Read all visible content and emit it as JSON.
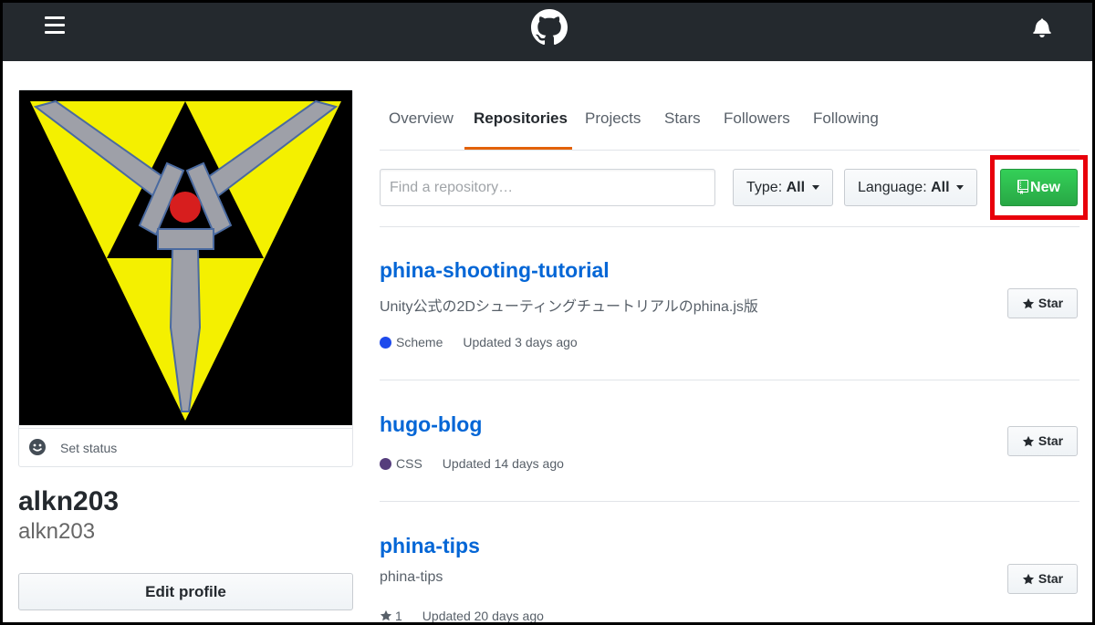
{
  "header": {
    "menu_icon": "hamburger-icon",
    "logo_icon": "github-octocat-icon",
    "notification_icon": "bell-icon"
  },
  "profile": {
    "avatar_alt": "avatar",
    "status_label": "Set status",
    "name": "alkn203",
    "username": "alkn203",
    "edit_button": "Edit profile"
  },
  "tabs": [
    {
      "label": "Overview",
      "active": false
    },
    {
      "label": "Repositories",
      "active": true
    },
    {
      "label": "Projects",
      "active": false
    },
    {
      "label": "Stars",
      "active": false
    },
    {
      "label": "Followers",
      "active": false
    },
    {
      "label": "Following",
      "active": false
    }
  ],
  "filters": {
    "search_placeholder": "Find a repository…",
    "type_label": "Type:",
    "type_value": "All",
    "language_label": "Language:",
    "language_value": "All",
    "new_button": "New"
  },
  "repos": [
    {
      "name": "phina-shooting-tutorial",
      "description": "Unity公式の2Dシューティングチュートリアルのphina.js版",
      "language": "Scheme",
      "language_color": "#1e4aec",
      "stars": "",
      "updated": "Updated 3 days ago",
      "star_button": "Star"
    },
    {
      "name": "hugo-blog",
      "description": "",
      "language": "CSS",
      "language_color": "#563d7c",
      "stars": "",
      "updated": "Updated 14 days ago",
      "star_button": "Star"
    },
    {
      "name": "phina-tips",
      "description": "phina-tips",
      "language": "",
      "language_color": "",
      "stars": "1",
      "updated": "Updated 20 days ago",
      "star_button": "Star"
    }
  ],
  "colors": {
    "accent_tab": "#e36209",
    "link": "#0366d6",
    "primary_button": "#28a745",
    "highlight": "#e8000b"
  }
}
